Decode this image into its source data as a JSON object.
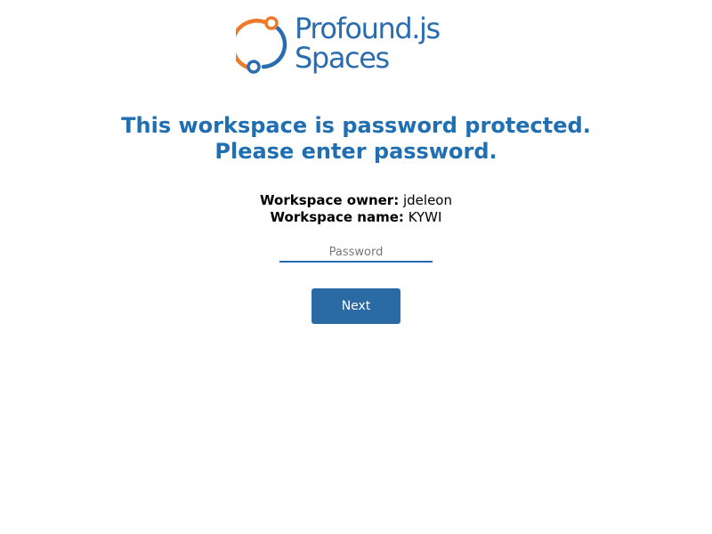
{
  "brand": {
    "line1": "Profound.js",
    "line2": "Spaces",
    "logo_icon": "profound-ring-logo-icon",
    "colors": {
      "blue": "#2a6cb0",
      "orange": "#ec7a2a"
    }
  },
  "heading": {
    "line1": "This workspace is password protected.",
    "line2": "Please enter password."
  },
  "workspace": {
    "owner_label": "Workspace owner:",
    "owner_value": "jdeleon",
    "name_label": "Workspace name:",
    "name_value": "KYWI"
  },
  "form": {
    "password_placeholder": "Password",
    "password_value": "",
    "next_label": "Next"
  },
  "colors": {
    "heading": "#1f6fb2",
    "button_bg": "#2a6aa5",
    "input_underline": "#2a6cb0"
  }
}
